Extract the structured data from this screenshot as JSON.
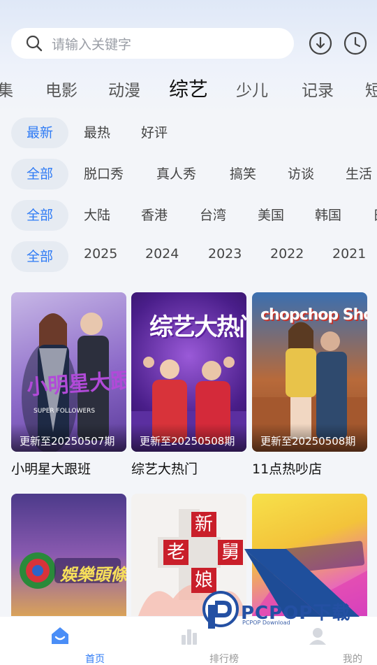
{
  "search": {
    "placeholder": "请输入关键字"
  },
  "categories": [
    "集",
    "电影",
    "动漫",
    "综艺",
    "少儿",
    "记录",
    "短"
  ],
  "active_category": "综艺",
  "filters": {
    "sort": [
      "最新",
      "最热",
      "好评"
    ],
    "type": [
      "全部",
      "脱口秀",
      "真人秀",
      "搞笑",
      "访谈",
      "生活"
    ],
    "region": [
      "全部",
      "大陆",
      "香港",
      "台湾",
      "美国",
      "韩国",
      "日"
    ],
    "year": [
      "全部",
      "2025",
      "2024",
      "2023",
      "2022",
      "2021"
    ]
  },
  "cards": [
    {
      "title": "小明星大跟班",
      "update": "更新至20250507期",
      "poster_text": "小明星大跟班",
      "poster_sub": "SUPER FOLLOWERS"
    },
    {
      "title": "综艺大热门",
      "update": "更新至20250508期",
      "poster_text": "综艺大热门"
    },
    {
      "title": "11点热吵店",
      "update": "更新至20250508期",
      "poster_text": "chopchop Show"
    }
  ],
  "cards_row2": [
    {
      "poster_text": "娛樂頭條"
    },
    {
      "poster_text": "新老舅娘",
      "chars": [
        "新",
        "老",
        "舅",
        "娘"
      ]
    },
    {
      "poster_text": ""
    }
  ],
  "tabbar": [
    {
      "label": "首页",
      "icon": "home-icon",
      "active": true
    },
    {
      "label": "排行榜",
      "icon": "chart-icon",
      "active": false
    },
    {
      "label": "我的",
      "icon": "user-icon",
      "active": false
    }
  ],
  "watermark": {
    "brand": "PCPOP下载",
    "sub": "PCPOP Download"
  },
  "colors": {
    "accent": "#2f7bf5",
    "chip_bg": "#e6ebf2",
    "watermark": "#1f4f9c"
  }
}
